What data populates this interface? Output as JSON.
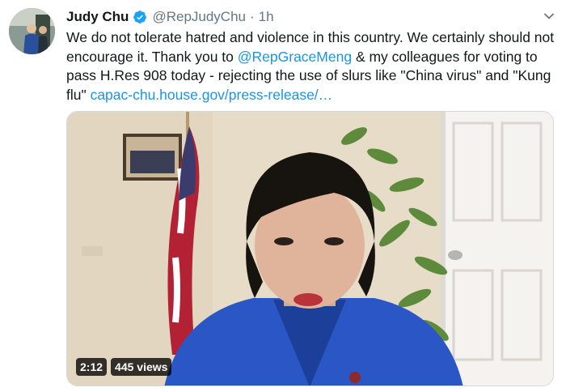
{
  "tweet": {
    "display_name": "Judy Chu",
    "handle": "@RepJudyChu",
    "separator": "·",
    "time": "1h",
    "text_part1": "We do not tolerate hatred and violence in this country. We certainly should not encourage it. Thank you to ",
    "mention": "@RepGraceMeng",
    "text_part2": " & my colleagues for voting to pass H.Res 908 today - rejecting the use of slurs like \"China virus\" and \"Kung flu\" ",
    "link": "capac-chu.house.gov/press-release/…"
  },
  "video": {
    "duration": "2:12",
    "views": "445 views"
  },
  "icons": {
    "verified": "verified-badge-icon",
    "more": "chevron-down-icon"
  },
  "colors": {
    "link": "#1b95e0",
    "secondary_text": "#657786",
    "verified": "#1da1f2"
  }
}
